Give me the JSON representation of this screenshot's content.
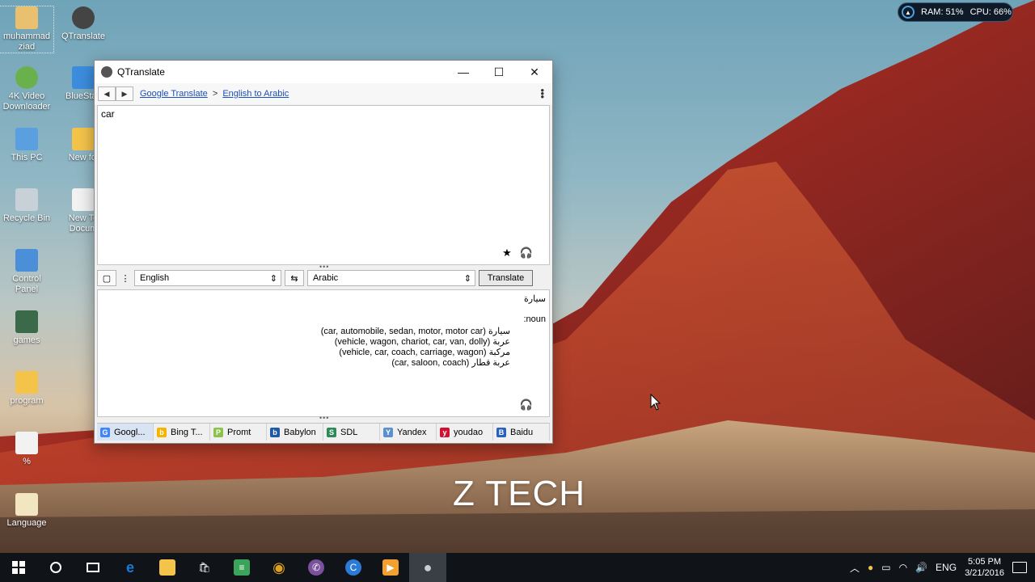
{
  "desktop": {
    "icons": [
      {
        "label": "muhammad ziad",
        "color": "#e8c070"
      },
      {
        "label": "QTranslate",
        "color": "#444444"
      },
      {
        "label": "4K Video Downloader",
        "color": "#6ab04c"
      },
      {
        "label": "BlueStac",
        "color": "#3c8dde"
      },
      {
        "label": "This PC",
        "color": "#5aa0e0"
      },
      {
        "label": "New fol",
        "color": "#f3c34a"
      },
      {
        "label": "Recycle Bin",
        "color": "#c8d0d8"
      },
      {
        "label": "New Te Docum",
        "color": "#f2f2f2"
      },
      {
        "label": "Control Panel",
        "color": "#4a8fd8"
      },
      {
        "label": "games",
        "color": "#3a6a4a"
      },
      {
        "label": "program",
        "color": "#f3c34a"
      },
      {
        "label": "%",
        "color": "#f2f2f2"
      },
      {
        "label": "Language",
        "color": "#f2e6c0"
      }
    ]
  },
  "sysmon": {
    "ram": "RAM: 51%",
    "cpu": "CPU: 66%"
  },
  "window": {
    "title": "QTranslate",
    "minimize_glyph": "—",
    "maximize_glyph": "☐",
    "close_glyph": "✕",
    "breadcrumb": {
      "service": "Google Translate",
      "separator": ">",
      "direction": "English to Arabic"
    },
    "source_text": "car",
    "source_lang": "English",
    "target_lang": "Arabic",
    "translate_label": "Translate",
    "result": {
      "main": "سيارة",
      "pos": ":noun",
      "lines": [
        {
          "arabic": "سيارة",
          "meanings": "(car, automobile, sedan, motor, motor car)"
        },
        {
          "arabic": "عربة",
          "meanings": "(vehicle, wagon, chariot, car, van, dolly)"
        },
        {
          "arabic": "مركبة",
          "meanings": "(vehicle, car, coach, carriage, wagon)"
        },
        {
          "arabic": "عربة قطار",
          "meanings": "(car, saloon, coach)"
        }
      ]
    },
    "engines": [
      {
        "label": "Googl...",
        "icon": "G",
        "color": "#4285f4"
      },
      {
        "label": "Bing T...",
        "icon": "b",
        "color": "#f4b400"
      },
      {
        "label": "Promt",
        "icon": "P",
        "color": "#8bc34a"
      },
      {
        "label": "Babylon",
        "icon": "b",
        "color": "#1e5aa8"
      },
      {
        "label": "SDL",
        "icon": "S",
        "color": "#2e8b57"
      },
      {
        "label": "Yandex",
        "icon": "Y",
        "color": "#5a8fd0"
      },
      {
        "label": "youdao",
        "icon": "y",
        "color": "#d01030"
      },
      {
        "label": "Baidu",
        "icon": "B",
        "color": "#2a60c0"
      }
    ]
  },
  "watermark": "Z TECH",
  "taskbar": {
    "apps": [
      {
        "name": "edge",
        "color": "#1a7ad6",
        "glyph": "e"
      },
      {
        "name": "file-explorer",
        "color": "#f3c34a",
        "glyph": "▬"
      },
      {
        "name": "store",
        "color": "#ffffff",
        "glyph": "🛍"
      },
      {
        "name": "notes",
        "color": "#3aa55a",
        "glyph": "≡"
      },
      {
        "name": "chrome",
        "color": "#e0a020",
        "glyph": "◉"
      },
      {
        "name": "viber",
        "color": "#7b519d",
        "glyph": "✆"
      },
      {
        "name": "ccleaner",
        "color": "#2a7ad6",
        "glyph": "C"
      },
      {
        "name": "media",
        "color": "#f3a030",
        "glyph": "▶"
      },
      {
        "name": "qtranslate",
        "color": "#444444",
        "glyph": "●"
      }
    ],
    "lang": "ENG",
    "time": "5:05 PM",
    "date": "3/21/2016"
  }
}
